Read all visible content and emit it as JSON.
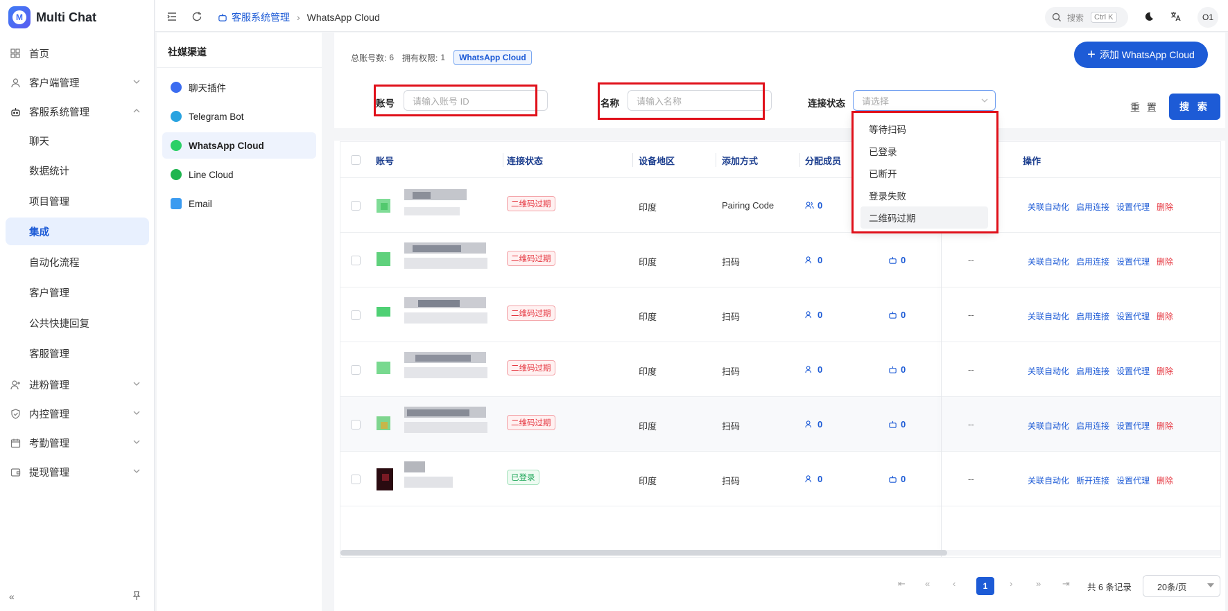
{
  "app": {
    "name": "Multi Chat",
    "logo_letter": "M"
  },
  "sidebar": {
    "items": [
      {
        "label": "首页",
        "icon": "grid-icon"
      },
      {
        "label": "客户端管理",
        "icon": "user-icon"
      },
      {
        "label": "客服系统管理",
        "icon": "robot-icon"
      },
      {
        "label": "聊天"
      },
      {
        "label": "数据统计"
      },
      {
        "label": "项目管理"
      },
      {
        "label": "集成"
      },
      {
        "label": "自动化流程"
      },
      {
        "label": "客户管理"
      },
      {
        "label": "公共快捷回复"
      },
      {
        "label": "客服管理"
      },
      {
        "label": "进粉管理",
        "icon": "user-plus-icon"
      },
      {
        "label": "内控管理",
        "icon": "shield-icon"
      },
      {
        "label": "考勤管理",
        "icon": "calendar-icon"
      },
      {
        "label": "提现管理",
        "icon": "wallet-icon"
      }
    ]
  },
  "header": {
    "breadcrumb": [
      "客服系统管理",
      "WhatsApp Cloud"
    ],
    "search_placeholder": "搜索",
    "search_shortcut": "Ctrl K",
    "avatar": "O1"
  },
  "channels": {
    "title": "社媒渠道",
    "items": [
      "聊天插件",
      "Telegram Bot",
      "WhatsApp Cloud",
      "Line Cloud",
      "Email"
    ]
  },
  "summary": {
    "total_label": "总账号数:",
    "total_value": "6",
    "perm_label": "拥有权限:",
    "perm_value": "1",
    "tag": "WhatsApp Cloud"
  },
  "add_button": "添加 WhatsApp Cloud",
  "filters": {
    "account_label": "账号",
    "account_placeholder": "请输入账号 ID",
    "name_label": "名称",
    "name_placeholder": "请输入名称",
    "status_label": "连接状态",
    "status_placeholder": "请选择",
    "reset": "重 置",
    "search": "搜 索"
  },
  "status_options": [
    "等待扫码",
    "已登录",
    "已断开",
    "登录失败",
    "二维码过期"
  ],
  "table": {
    "columns": [
      "账号",
      "连接状态",
      "设备地区",
      "添加方式",
      "分配成员",
      "操作"
    ],
    "rows": [
      {
        "status": "二维码过期",
        "status_kind": "red",
        "region": "印度",
        "method": "Pairing Code",
        "members": "0",
        "bots": "",
        "extra": "",
        "ops": [
          "关联自动化",
          "启用连接",
          "设置代理",
          "删除"
        ]
      },
      {
        "status": "二维码过期",
        "status_kind": "red",
        "region": "印度",
        "method": "扫码",
        "members": "0",
        "bots": "0",
        "extra": "--",
        "ops": [
          "关联自动化",
          "启用连接",
          "设置代理",
          "删除"
        ]
      },
      {
        "status": "二维码过期",
        "status_kind": "red",
        "region": "印度",
        "method": "扫码",
        "members": "0",
        "bots": "0",
        "extra": "--",
        "ops": [
          "关联自动化",
          "启用连接",
          "设置代理",
          "删除"
        ]
      },
      {
        "status": "二维码过期",
        "status_kind": "red",
        "region": "印度",
        "method": "扫码",
        "members": "0",
        "bots": "0",
        "extra": "--",
        "ops": [
          "关联自动化",
          "启用连接",
          "设置代理",
          "删除"
        ]
      },
      {
        "status": "二维码过期",
        "status_kind": "red",
        "region": "印度",
        "method": "扫码",
        "members": "0",
        "bots": "0",
        "extra": "--",
        "ops": [
          "关联自动化",
          "启用连接",
          "设置代理",
          "删除"
        ]
      },
      {
        "status": "已登录",
        "status_kind": "green",
        "region": "印度",
        "method": "扫码",
        "members": "0",
        "bots": "0",
        "extra": "--",
        "ops": [
          "关联自动化",
          "断开连接",
          "设置代理",
          "删除"
        ]
      }
    ]
  },
  "pagination": {
    "current": "1",
    "total_text": "共 6 条记录",
    "page_size": "20条/页"
  },
  "colors": {
    "primary": "#1d5bd6",
    "danger": "#e5333d",
    "success": "#1fa759",
    "highlight_box": "#e0101a"
  }
}
